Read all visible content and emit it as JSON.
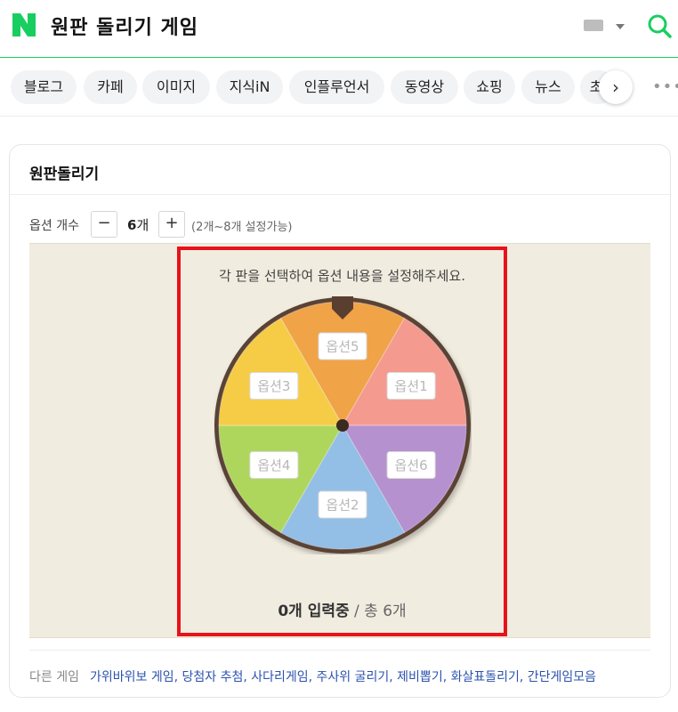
{
  "header": {
    "logo": "N",
    "title": "원판 돌리기 게임"
  },
  "tabs": [
    "블로그",
    "카페",
    "이미지",
    "지식iN",
    "인플루언서",
    "동영상",
    "쇼핑",
    "뉴스",
    "초"
  ],
  "card": {
    "title": "원판돌리기",
    "option_count_label": "옵션 개수",
    "count_value": "6",
    "count_unit": "개",
    "range_text": "(2개~8개 설정가능)",
    "hint": "각 판을 선택하여 옵션 내용을 설정해주세요.",
    "wheel": {
      "segments": [
        {
          "label": "옵션5",
          "color": "#f0a347"
        },
        {
          "label": "옵션1",
          "color": "#f59a8f"
        },
        {
          "label": "옵션6",
          "color": "#b592cf"
        },
        {
          "label": "옵션2",
          "color": "#93bee6"
        },
        {
          "label": "옵션4",
          "color": "#aed65d"
        },
        {
          "label": "옵션3",
          "color": "#f6cc46"
        }
      ]
    },
    "input_status": {
      "lead": "0개 입력중",
      "sep": " / ",
      "total": "총 6개"
    },
    "other_games_label": "다른 게임",
    "other_games": "가위바위보 게임, 당첨자 추첨, 사다리게임, 주사위 굴리기, 제비뽑기, 화살표돌리기, 간단게임모음"
  },
  "colors": {
    "brand": "#19ce60",
    "highlight": "#e8121b",
    "link": "#2b52ad"
  },
  "icons": {
    "search": "search-icon",
    "keyboard": "keyboard-icon",
    "next": "chevron-right-icon",
    "more": "more-icon"
  }
}
